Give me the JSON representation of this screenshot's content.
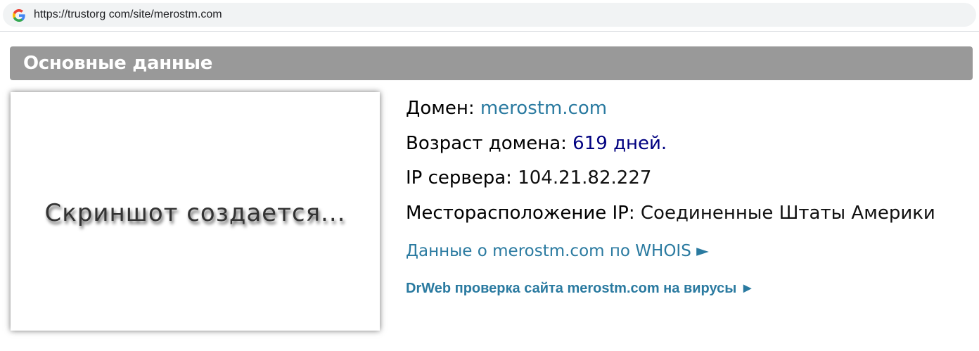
{
  "browser": {
    "url": "https://trustorg com/site/merostm.com",
    "icon": "google-g-icon"
  },
  "section": {
    "title": "Основные данные"
  },
  "screenshot": {
    "placeholder": "Скриншот создается..."
  },
  "info": {
    "domain_label": "Домен:",
    "domain_value": "merostm.com",
    "age_label": "Возраст домена:",
    "age_value": "619 дней.",
    "ip_label": "IP сервера:",
    "ip_value": "104.21.82.227",
    "location_label": "Месторасположение IP:",
    "location_value": "Соединенные Штаты Америки",
    "whois_link": "Данные о merostm.com по WHOIS ►",
    "drweb_link": "DrWeb проверка сайта merostm.com на вирусы ►"
  },
  "colors": {
    "link": "#2a7aa0",
    "age": "#000080",
    "header_bg": "#999999"
  }
}
